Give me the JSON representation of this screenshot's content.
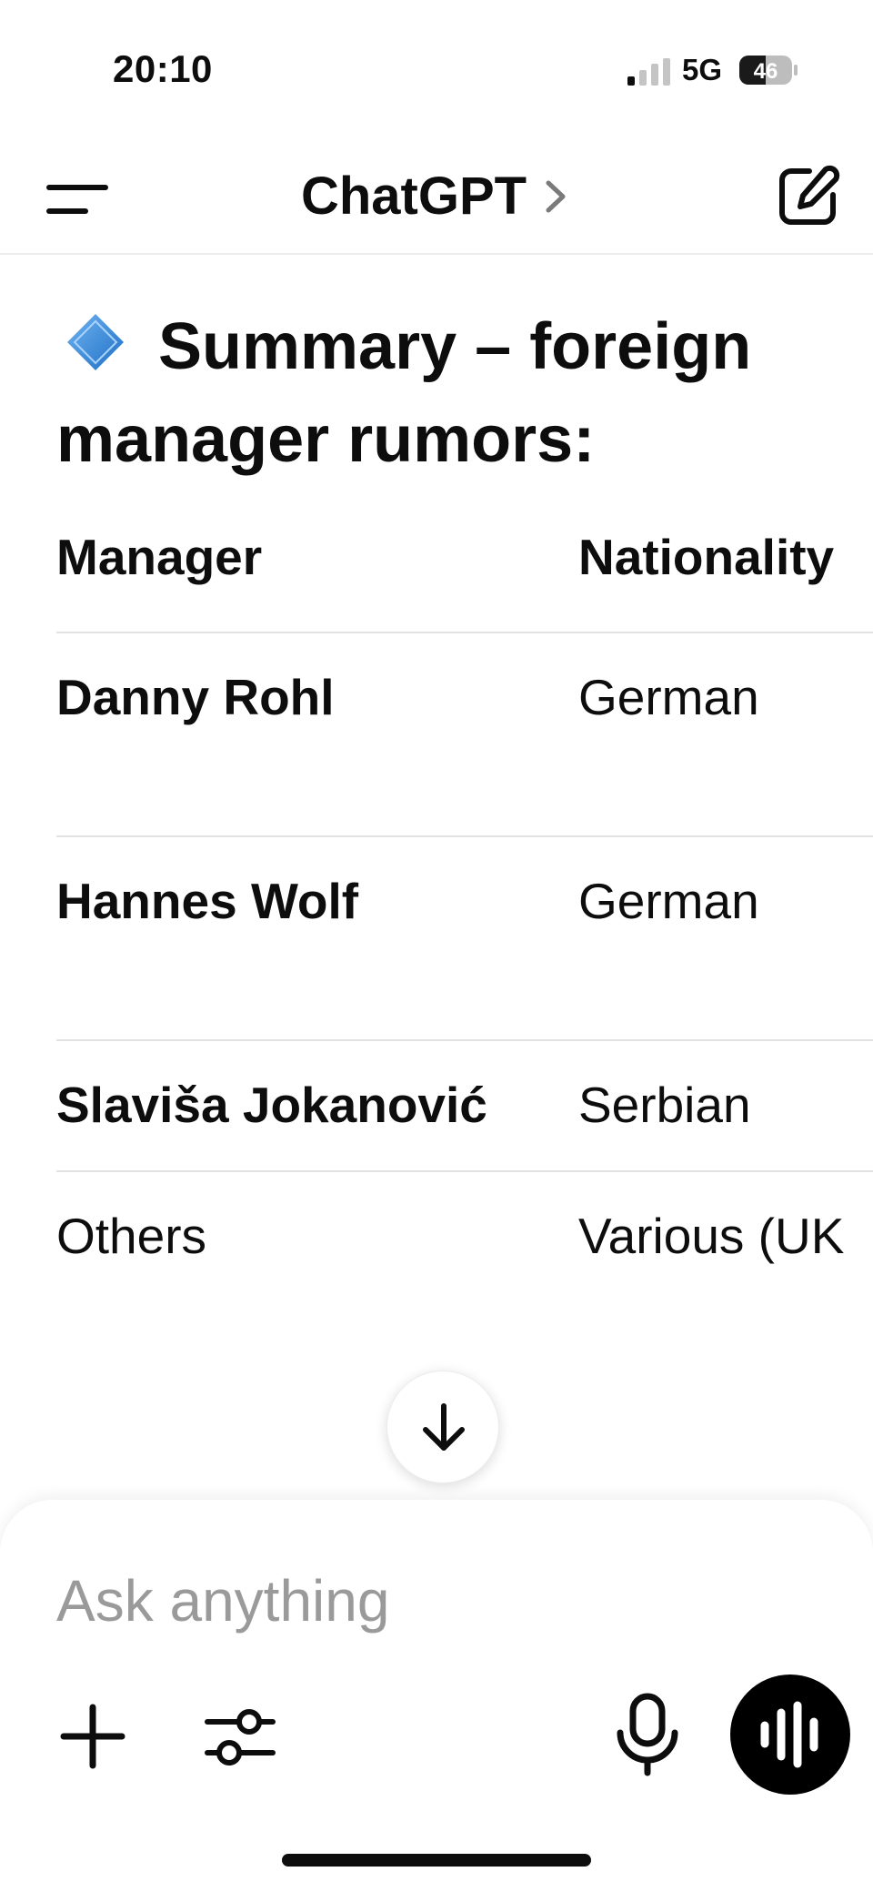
{
  "status_bar": {
    "time": "20:10",
    "network": "5G",
    "battery": "46"
  },
  "nav": {
    "title": "ChatGPT",
    "icons": [
      "menu-icon",
      "chevron-right-icon",
      "new-chat-icon"
    ]
  },
  "message": {
    "heading": "Summary – foreign manager rumors:",
    "heading_icon": "blue-diamond-icon",
    "table": {
      "headers": [
        "Manager",
        "Nationality"
      ],
      "rows": [
        {
          "manager": "Danny Rohl",
          "nationality": "German"
        },
        {
          "manager": "Hannes Wolf",
          "nationality": "German"
        },
        {
          "manager": "Slaviša Jokanović",
          "nationality": "Serbian"
        },
        {
          "manager": "Others",
          "nationality": "Various (UK"
        }
      ]
    }
  },
  "composer": {
    "placeholder": "Ask anything",
    "icons": [
      "plus-icon",
      "tools-icon",
      "microphone-icon",
      "voice-mode-icon",
      "scroll-down-icon"
    ]
  },
  "colors": {
    "accent_diamond": "#3a86d6",
    "text": "#0d0d0d",
    "placeholder": "#9a9a9a",
    "divider": "#e2e2e2"
  }
}
